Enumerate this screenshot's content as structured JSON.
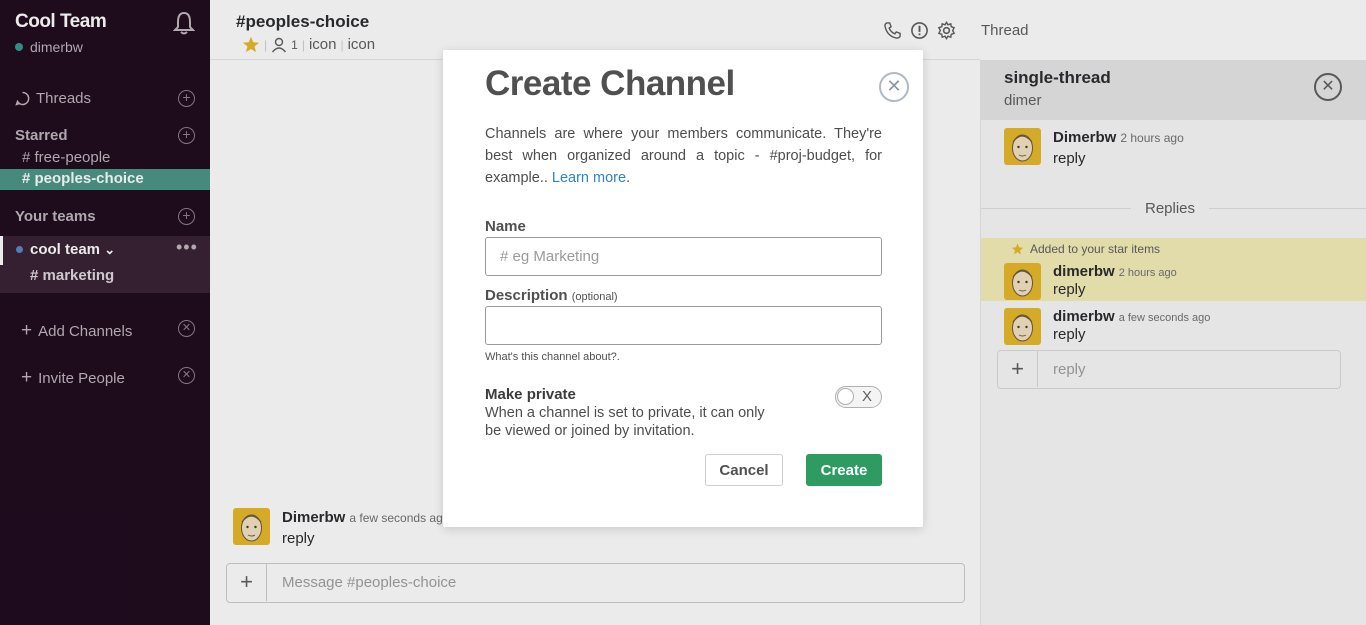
{
  "sidebar": {
    "team_name": "Cool Team",
    "username": "dimerbw",
    "threads_label": "Threads",
    "starred_label": "Starred",
    "starred_channels": [
      "# free-people",
      "# peoples-choice"
    ],
    "your_teams_label": "Your teams",
    "team_item": "cool team",
    "team_chevron": "⌄",
    "team_channel": "# marketing",
    "add_channels": "Add Channels",
    "invite_people": "Invite People",
    "more_glyph": "•••"
  },
  "header": {
    "channel_title": "#peoples-choice",
    "member_count": "1",
    "meta_icon_1": "icon",
    "meta_icon_2": "icon",
    "thread_tab": "Thread"
  },
  "message": {
    "author": "Dimerbw",
    "time": "a few seconds ago",
    "text": "reply"
  },
  "composer": {
    "placeholder": "Message #peoples-choice"
  },
  "thread": {
    "title": "single-thread",
    "subtitle": "dimer",
    "root": {
      "author": "Dimerbw",
      "time": "2 hours ago",
      "text": "reply"
    },
    "replies_label": "Replies",
    "star_note": "Added to your star items",
    "replies": [
      {
        "author": "dimerbw",
        "time": "2 hours ago",
        "text": "reply"
      },
      {
        "author": "dimerbw",
        "time": "a few seconds ago",
        "text": "reply"
      }
    ],
    "composer_placeholder": "reply"
  },
  "modal": {
    "title": "Create Channel",
    "description": "Channels are where your members communicate. They're best when organized around a topic - #proj-budget, for example.. ",
    "learn_more": "Learn more",
    "name_label": "Name",
    "name_placeholder": "# eg Marketing",
    "description_label": "Description",
    "optional": "(optional)",
    "description_hint": "What's this channel about?.",
    "private_label": "Make private",
    "private_desc": "When a channel is set to private, it can only be viewed or joined by invitation.",
    "toggle_off_glyph": "X",
    "cancel": "Cancel",
    "create": "Create"
  },
  "colors": {
    "sidebar_bg": "#210c1f",
    "selected_channel": "#4c9689",
    "create_button": "#2e9c62",
    "star_highlight": "#f6efb9",
    "link": "#2d83c6"
  }
}
